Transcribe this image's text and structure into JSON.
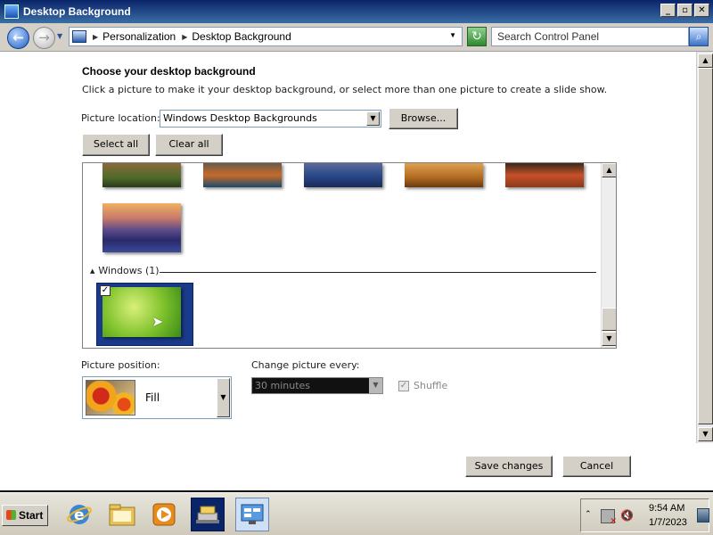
{
  "window": {
    "title": "Desktop Background",
    "minimize": "_",
    "restore": "▫",
    "close": "✕"
  },
  "address": {
    "back_glyph": "←",
    "forward_glyph": "→",
    "crumbs": [
      "Personalization",
      "Desktop Background"
    ],
    "refresh_glyph": "↻",
    "search_placeholder": "Search Control Panel"
  },
  "content": {
    "heading": "Choose your desktop background",
    "description": "Click a picture to make it your desktop background, or select more than one picture to create a slide show.",
    "picture_location_label": "Picture location:",
    "picture_location_value": "Windows Desktop Backgrounds",
    "browse_label": "Browse...",
    "select_all_label": "Select all",
    "clear_all_label": "Clear all",
    "group_label": "Windows (1)",
    "picture_position_label": "Picture position:",
    "picture_position_value": "Fill",
    "change_picture_label": "Change picture every:",
    "change_picture_value": "30 minutes",
    "shuffle_label": "Shuffle",
    "shuffle_checked": true,
    "save_label": "Save changes",
    "cancel_label": "Cancel"
  },
  "taskbar": {
    "start_label": "Start",
    "time": "9:54 AM",
    "date": "1/7/2023"
  },
  "icons": {
    "back": "back-arrow-icon",
    "forward": "forward-arrow-icon",
    "search": "search-icon",
    "refresh": "refresh-icon",
    "ie": "internet-explorer-icon",
    "explorer": "explorer-folder-icon",
    "media": "media-player-icon",
    "server": "server-manager-icon",
    "control_panel": "control-panel-icon"
  },
  "colors": {
    "accent": "#0a246a",
    "selection": "#1a3a8a"
  }
}
